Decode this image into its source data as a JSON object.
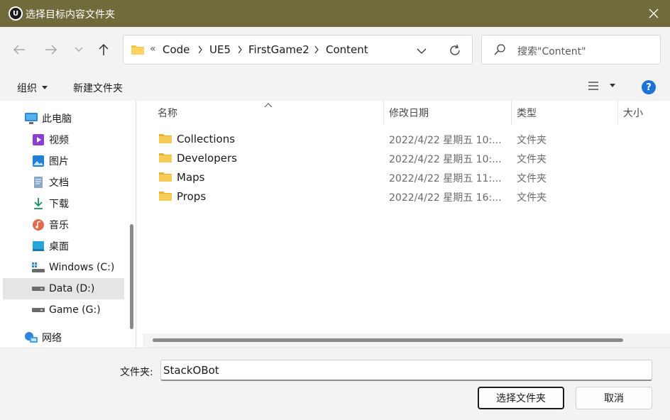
{
  "window": {
    "title": "选择目标内容文件夹",
    "logo_letter": "U"
  },
  "nav": {
    "back_glyph": "←",
    "forward_glyph": "→",
    "recent_glyph": "⌄",
    "up_glyph": "↑"
  },
  "address": {
    "overflow": "«",
    "crumbs": [
      "Code",
      "UE5",
      "FirstGame2",
      "Content"
    ]
  },
  "search": {
    "placeholder": "搜索\"Content\""
  },
  "toolbar": {
    "organize": "组织",
    "new_folder": "新建文件夹",
    "help": "?"
  },
  "sidebar": {
    "items": [
      {
        "label": "此电脑",
        "icon": "computer-icon"
      },
      {
        "label": "视频",
        "icon": "video-icon"
      },
      {
        "label": "图片",
        "icon": "pictures-icon"
      },
      {
        "label": "文档",
        "icon": "documents-icon"
      },
      {
        "label": "下载",
        "icon": "download-icon"
      },
      {
        "label": "音乐",
        "icon": "music-icon"
      },
      {
        "label": "桌面",
        "icon": "desktop-icon"
      },
      {
        "label": "Windows (C:)",
        "icon": "windows-drive-icon"
      },
      {
        "label": "Data (D:)",
        "icon": "drive-icon"
      },
      {
        "label": "Game (G:)",
        "icon": "drive-icon"
      },
      {
        "label": "网络",
        "icon": "network-icon"
      }
    ],
    "selected_index": 8
  },
  "columns": {
    "name": "名称",
    "date": "修改日期",
    "type": "类型",
    "size": "大小"
  },
  "files": [
    {
      "name": "Collections",
      "date": "2022/4/22 星期五 10:...",
      "type": "文件夹"
    },
    {
      "name": "Developers",
      "date": "2022/4/22 星期五 10:...",
      "type": "文件夹"
    },
    {
      "name": "Maps",
      "date": "2022/4/22 星期五 11:...",
      "type": "文件夹"
    },
    {
      "name": "Props",
      "date": "2022/4/22 星期五 16:...",
      "type": "文件夹"
    }
  ],
  "bottom": {
    "folder_label": "文件夹:",
    "folder_value": "StackOBot",
    "select_button": "选择文件夹",
    "cancel_button": "取消"
  },
  "colors": {
    "titlebar": "#6f6b3b",
    "folder": "#f5c342",
    "help": "#1e73d8"
  }
}
